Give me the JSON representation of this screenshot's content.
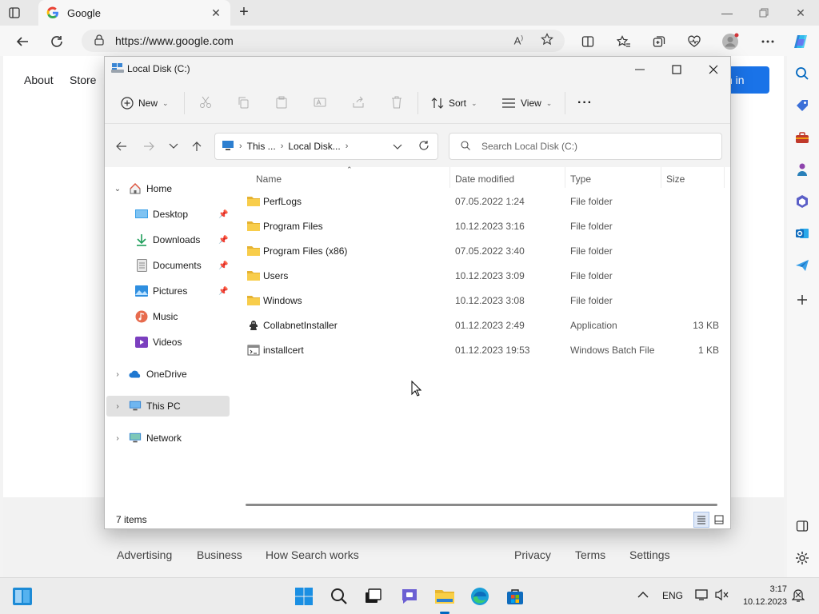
{
  "browser": {
    "tab_title": "Google",
    "url": "https://www.google.com"
  },
  "google": {
    "nav_about": "About",
    "nav_store": "Store",
    "signin_label": "n in",
    "footer": {
      "advertising": "Advertising",
      "business": "Business",
      "how_search_works": "How Search works",
      "privacy": "Privacy",
      "terms": "Terms",
      "settings": "Settings"
    }
  },
  "explorer": {
    "title": "Local Disk (C:)",
    "toolbar": {
      "new_label": "New",
      "sort_label": "Sort",
      "view_label": "View",
      "more_label": "···"
    },
    "breadcrumb": [
      "This ...",
      "Local Disk..."
    ],
    "search_placeholder": "Search Local Disk (C:)",
    "nav_pane": [
      {
        "label": "Home",
        "icon": "home-icon"
      },
      {
        "label": "Desktop",
        "icon": "desktop-icon",
        "pinned": true
      },
      {
        "label": "Downloads",
        "icon": "downloads-icon",
        "pinned": true
      },
      {
        "label": "Documents",
        "icon": "documents-icon",
        "pinned": true
      },
      {
        "label": "Pictures",
        "icon": "pictures-icon",
        "pinned": true
      },
      {
        "label": "Music",
        "icon": "music-icon"
      },
      {
        "label": "Videos",
        "icon": "videos-icon"
      },
      {
        "label": "OneDrive",
        "icon": "onedrive-icon"
      },
      {
        "label": "This PC",
        "icon": "this-pc-icon",
        "selected": true
      },
      {
        "label": "Network",
        "icon": "network-icon"
      }
    ],
    "columns": {
      "name": "Name",
      "date": "Date modified",
      "type": "Type",
      "size": "Size"
    },
    "files": [
      {
        "name": "PerfLogs",
        "date": "07.05.2022 1:24",
        "type": "File folder",
        "size": "",
        "icon": "folder-icon"
      },
      {
        "name": "Program Files",
        "date": "10.12.2023 3:16",
        "type": "File folder",
        "size": "",
        "icon": "folder-icon"
      },
      {
        "name": "Program Files (x86)",
        "date": "07.05.2022 3:40",
        "type": "File folder",
        "size": "",
        "icon": "folder-icon"
      },
      {
        "name": "Users",
        "date": "10.12.2023 3:09",
        "type": "File folder",
        "size": "",
        "icon": "folder-icon"
      },
      {
        "name": "Windows",
        "date": "10.12.2023 3:08",
        "type": "File folder",
        "size": "",
        "icon": "folder-icon"
      },
      {
        "name": "CollabnetInstaller",
        "date": "01.12.2023 2:49",
        "type": "Application",
        "size": "13 KB",
        "icon": "application-icon"
      },
      {
        "name": "installcert",
        "date": "01.12.2023 19:53",
        "type": "Windows Batch File",
        "size": "1 KB",
        "icon": "batch-file-icon"
      }
    ],
    "status": "7 items"
  },
  "taskbar": {
    "language": "ENG",
    "time": "3:17",
    "date": "10.12.2023"
  },
  "colors": {
    "accent": "#0067c0",
    "folder": "#f7c948",
    "google_blue": "#1a73e8"
  }
}
